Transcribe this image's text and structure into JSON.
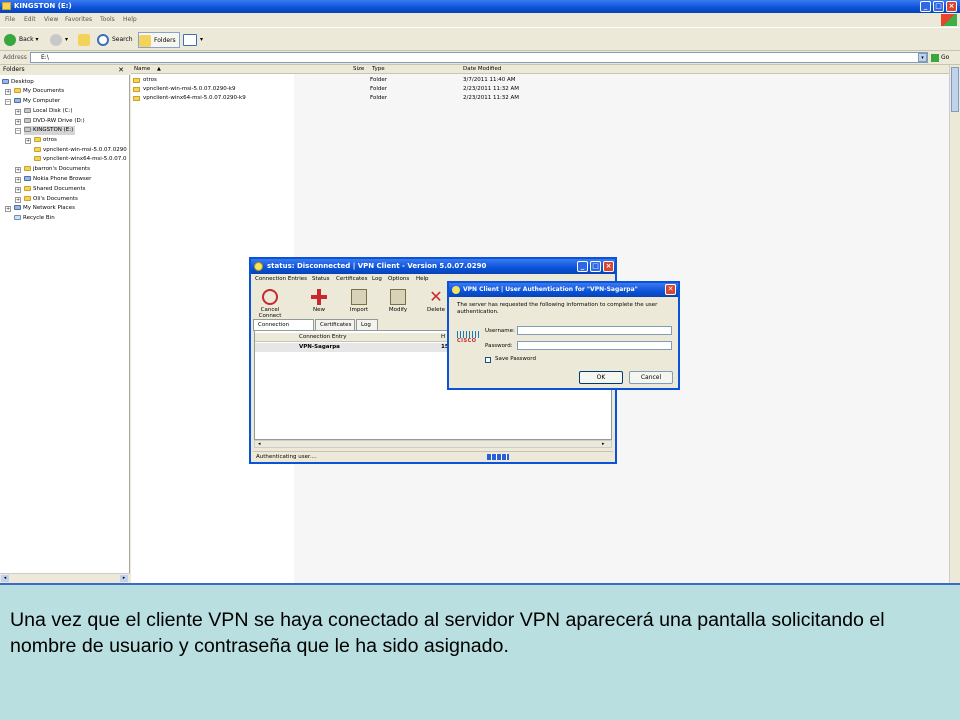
{
  "explorer": {
    "title": "KINGSTON (E:)",
    "menu": [
      "File",
      "Edit",
      "View",
      "Favorites",
      "Tools",
      "Help"
    ],
    "toolbar": {
      "back": "Back",
      "search": "Search",
      "folders": "Folders"
    },
    "address": {
      "label": "Address",
      "value": "E:\\",
      "go": "Go"
    },
    "folders_pane": {
      "header": "Folders",
      "close": "✕",
      "tree": [
        "Desktop",
        "My Documents",
        "My Computer",
        "Local Disk (C:)",
        "DVD-RW Drive (D:)",
        "KINGSTON (E:)",
        "otros",
        "vpnclient-win-msi-5.0.07.0290",
        "vpnclient-winx64-msi-5.0.07.0",
        "jbarron's Documents",
        "Nokia Phone Browser",
        "Shared Documents",
        "Oli's Documents",
        "My Network Places",
        "Recycle Bin"
      ]
    },
    "columns": {
      "name": "Name",
      "size": "Size",
      "type": "Type",
      "date": "Date Modified"
    },
    "files": [
      {
        "name": "otros",
        "type": "Folder",
        "date": "3/7/2011 11:40 AM"
      },
      {
        "name": "vpnclient-win-msi-5.0.07.0290-k9",
        "type": "Folder",
        "date": "2/23/2011 11:32 AM"
      },
      {
        "name": "vpnclient-winx64-msi-5.0.07.0290-k9",
        "type": "Folder",
        "date": "2/23/2011 11:32 AM"
      }
    ]
  },
  "vpn_client": {
    "title": "status: Disconnected | VPN Client - Version 5.0.07.0290",
    "menu": [
      "Connection Entries",
      "Status",
      "Certificates",
      "Log",
      "Options",
      "Help"
    ],
    "tools": [
      "Cancel Connect",
      "New",
      "Import",
      "Modify",
      "Delete"
    ],
    "tabs": [
      "Connection Entries",
      "Certificates",
      "Log"
    ],
    "list_header": {
      "entry": "Connection Entry",
      "host": "H"
    },
    "entry": {
      "name": "VPN-Sagarpa",
      "host": "15"
    },
    "status": "Authenticating user...."
  },
  "auth_dialog": {
    "title": "VPN Client  |  User Authentication for \"VPN-Sagarpa\"",
    "message": "The server has requested the following information to complete the user authentication.",
    "logo_text": "CISCO",
    "username_label": "Username:",
    "password_label": "Password:",
    "save_password_label": "Save Password",
    "ok": "OK",
    "cancel": "Cancel",
    "close": "✕"
  },
  "caption": "Una vez que el cliente VPN se haya conectado al servidor VPN aparecerá una pantalla solicitando el nombre de usuario y contraseña que le ha sido asignado."
}
